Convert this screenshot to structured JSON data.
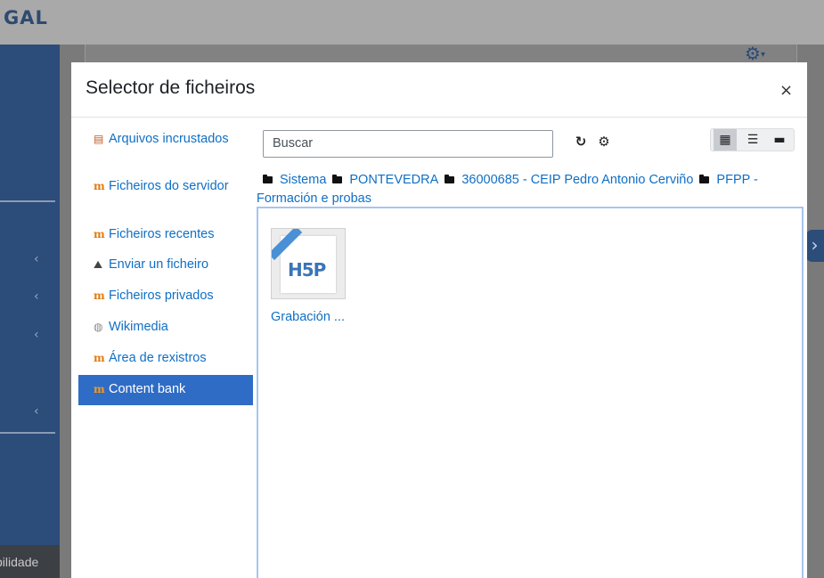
{
  "background": {
    "logo_text": "GAL",
    "footer_text": "bilidade",
    "gear_icon": "gear-icon",
    "chevron": "‹",
    "right_tab": "›"
  },
  "modal": {
    "title": "Selector de ficheiros",
    "close_label": "×"
  },
  "nav": {
    "items": [
      {
        "label": "Arquivos incrustados",
        "icon": "document-icon"
      },
      {
        "label": "Ficheiros do servidor",
        "icon": "moodle-icon"
      },
      {
        "label": "Ficheiros recentes",
        "icon": "moodle-icon"
      },
      {
        "label": "Enviar un ficheiro",
        "icon": "upload-icon"
      },
      {
        "label": "Ficheiros privados",
        "icon": "moodle-icon"
      },
      {
        "label": "Wikimedia",
        "icon": "wikimedia-icon"
      },
      {
        "label": "Área de rexistros",
        "icon": "moodle-icon"
      },
      {
        "label": "Content bank",
        "icon": "moodle-icon",
        "active": true
      }
    ]
  },
  "toolbar": {
    "search_placeholder": "Buscar",
    "refresh_icon": "refresh-icon",
    "settings_icon": "settings-icon",
    "view_icons": [
      "grid-view-icon",
      "list-view-icon",
      "folder-view-icon"
    ],
    "selected_view": "grid-view-icon"
  },
  "path": {
    "segments": [
      "Sistema",
      "PONTEVEDRA",
      "36000685 - CEIP Pedro Antonio Cerviño",
      "PFPP - Formación e probas"
    ]
  },
  "files": [
    {
      "name": "Grabación ...",
      "thumb_text": "H5P"
    }
  ],
  "colors": {
    "link": "#0f6fc5",
    "active_nav": "#2f6cc6",
    "sidebar": "#2c4c7a"
  }
}
